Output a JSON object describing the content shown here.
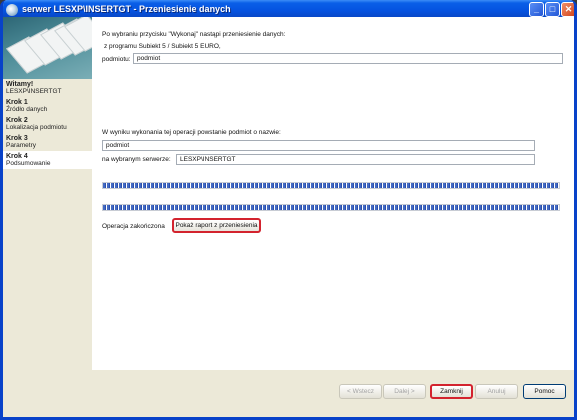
{
  "window": {
    "title": "serwer LESXP\\INSERTGT - Przeniesienie danych"
  },
  "sidebar": {
    "welcome": {
      "heading": "Witamy!",
      "detail": "LESXP\\INSERTGT"
    },
    "steps": [
      {
        "heading": "Krok 1",
        "detail": "Źródło danych"
      },
      {
        "heading": "Krok 2",
        "detail": "Lokalizacja podmiotu"
      },
      {
        "heading": "Krok 3",
        "detail": "Parametry"
      },
      {
        "heading": "Krok 4",
        "detail": "Podsumowanie"
      }
    ],
    "active_step": "Krok 4"
  },
  "main": {
    "intro": "Po wybraniu przycisku \"Wykonaj\" nastąpi przeniesienie danych:",
    "source_line": "z programu Subiekt 5 / Subiekt 5 EURO,",
    "source_label": "podmiotu:",
    "source_value": "podmiot",
    "result_text": "W wyniku wykonania tej operacji powstanie podmiot o nazwie:",
    "target_value": "podmiot",
    "server_label": "na wybranym serwerze:",
    "server_value": "LESXP\\INSERTGT",
    "progress_1": 1.0,
    "progress_2": 1.0,
    "status": "Operacja zakończona",
    "report_button": "Pokaż raport z przeniesienia"
  },
  "footer": {
    "back": "< Wstecz",
    "next": "Dalej >",
    "close": "Zamknij",
    "cancel": "Anuluj",
    "help": "Pomoc"
  }
}
